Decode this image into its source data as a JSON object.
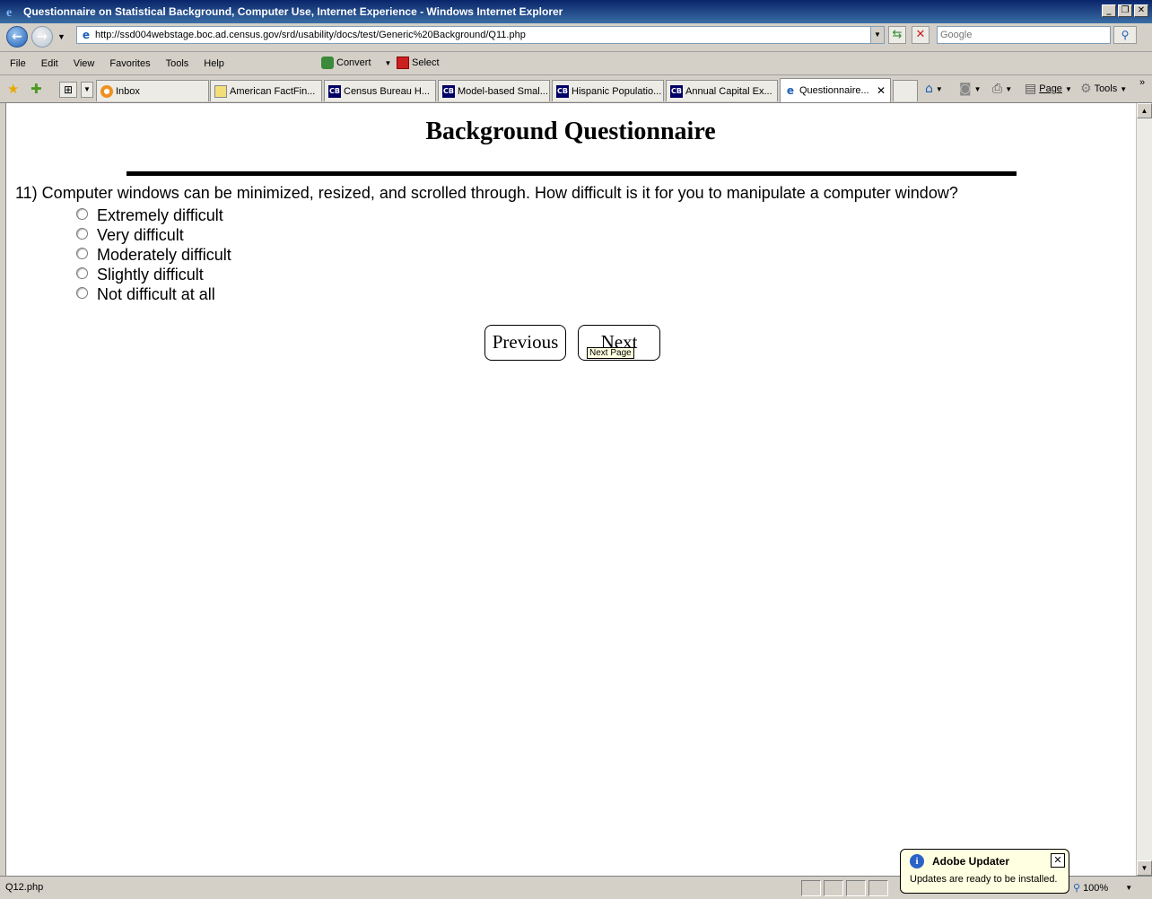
{
  "window": {
    "title": "Questionnaire on Statistical Background, Computer Use, Internet Experience - Windows Internet Explorer",
    "controls": [
      "minimize",
      "restore",
      "close"
    ]
  },
  "address_bar": {
    "url": "http://ssd004webstage.boc.ad.census.gov/srd/usability/docs/test/Generic%20Background/Q11.php",
    "search_placeholder": "Google"
  },
  "menu": {
    "items": [
      "File",
      "Edit",
      "View",
      "Favorites",
      "Tools",
      "Help"
    ],
    "convert_label": "Convert",
    "select_label": "Select"
  },
  "tabs": [
    {
      "label": "Inbox",
      "icon": "inbox-icon"
    },
    {
      "label": "American FactFin...",
      "icon": "factfinder-icon"
    },
    {
      "label": "Census Bureau H...",
      "icon": "census-icon"
    },
    {
      "label": "Model-based Smal...",
      "icon": "census-icon"
    },
    {
      "label": "Hispanic Populatio...",
      "icon": "census-icon"
    },
    {
      "label": "Annual Capital Ex...",
      "icon": "census-icon"
    },
    {
      "label": "Questionnaire...",
      "icon": "ie-page-icon",
      "active": true
    }
  ],
  "command_bar": {
    "page_label": "Page",
    "tools_label": "Tools"
  },
  "page": {
    "heading": "Background Questionnaire",
    "question": "11) Computer windows can be minimized, resized, and scrolled through. How difficult is it for you to manipulate a computer window?",
    "options": [
      "Extremely difficult",
      "Very difficult",
      "Moderately difficult",
      "Slightly difficult",
      "Not difficult at all"
    ],
    "previous_label": "Previous",
    "next_label": "Next",
    "tooltip": "Next Page"
  },
  "status_bar": {
    "text": "Q12.php",
    "zoom": "100%"
  },
  "notification": {
    "title": "Adobe Updater",
    "message": "Updates are ready to be installed."
  }
}
